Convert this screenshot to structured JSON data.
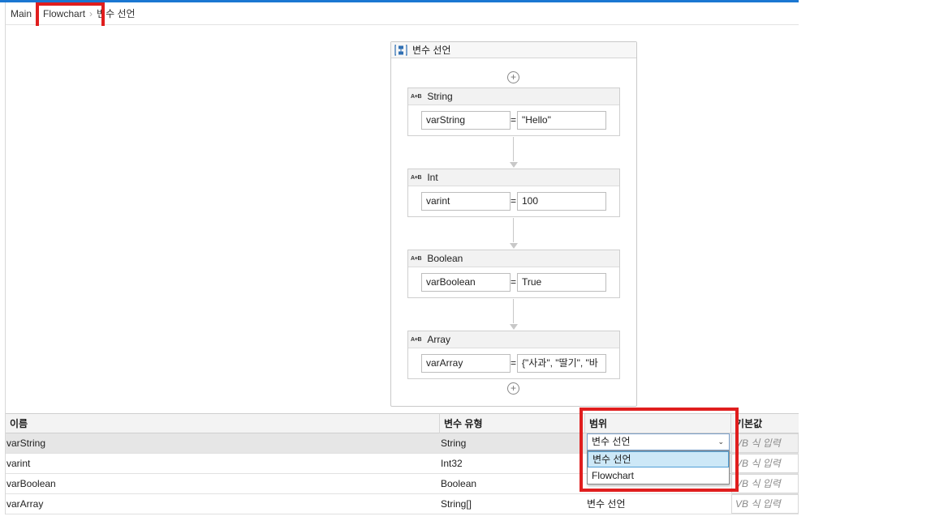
{
  "breadcrumb": {
    "items": [
      "Main",
      "Flowchart",
      "변수 선언"
    ]
  },
  "sequence": {
    "title": "변수 선언"
  },
  "activities": [
    {
      "type_label": "String",
      "variable": "varString",
      "value": "\"Hello\""
    },
    {
      "type_label": "Int",
      "variable": "varint",
      "value": "100"
    },
    {
      "type_label": "Boolean",
      "variable": "varBoolean",
      "value": "True"
    },
    {
      "type_label": "Array",
      "variable": "varArray",
      "value": "{\"사과\", \"딸기\", \"바"
    }
  ],
  "activity_icon_text": "A+B",
  "variables_panel": {
    "columns": [
      "이름",
      "변수 유형",
      "범위",
      "기본값"
    ],
    "rows": [
      {
        "name": "varString",
        "type": "String",
        "scope": "변수 선언",
        "default_placeholder": "VB 식 입력"
      },
      {
        "name": "varint",
        "type": "Int32",
        "scope": "변수 선언",
        "default_placeholder": "VB 식 입력"
      },
      {
        "name": "varBoolean",
        "type": "Boolean",
        "scope": "변수 선언",
        "default_placeholder": "VB 식 입력"
      },
      {
        "name": "varArray",
        "type": "String[]",
        "scope": "변수 선언",
        "default_placeholder": "VB 식 입력"
      }
    ],
    "scope_dropdown": {
      "selected": "변수 선언",
      "options": [
        "변수 선언",
        "Flowchart"
      ]
    }
  },
  "colors": {
    "accent": "#1b77d2",
    "highlight": "#e01e1e",
    "selection": "#cde8f7"
  },
  "icons": [
    "sequence-icon",
    "chevron-right-icon",
    "plus-circle-icon",
    "assign-icon",
    "chevron-down-icon"
  ]
}
